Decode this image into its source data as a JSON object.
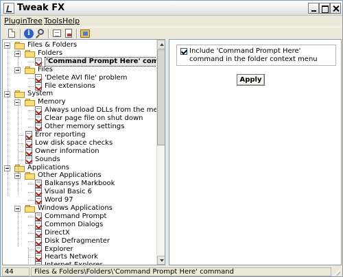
{
  "window": {
    "title": "Tweak FX"
  },
  "menu": [
    {
      "label": "Plugin"
    },
    {
      "label": "Tree"
    },
    {
      "label": "Tools"
    },
    {
      "label": "Help"
    }
  ],
  "tree": [
    {
      "label": "Files & Folders",
      "type": "folder",
      "level": 0,
      "expandable": true
    },
    {
      "label": "Folders",
      "type": "folder",
      "level": 1,
      "expandable": true
    },
    {
      "label": "'Command Prompt Here' command",
      "type": "item",
      "level": 2,
      "selected": true
    },
    {
      "label": "Files",
      "type": "folder",
      "level": 1,
      "expandable": true
    },
    {
      "label": "'Delete AVI file' problem",
      "type": "item",
      "level": 2
    },
    {
      "label": "File extensions",
      "type": "item",
      "level": 2
    },
    {
      "label": "System",
      "type": "folder",
      "level": 0,
      "expandable": true
    },
    {
      "label": "Memory",
      "type": "folder",
      "level": 1,
      "expandable": true
    },
    {
      "label": "Always unload DLLs from the memory",
      "type": "item",
      "level": 2
    },
    {
      "label": "Clear page file on shut down",
      "type": "item",
      "level": 2
    },
    {
      "label": "Other memory settings",
      "type": "item",
      "level": 2
    },
    {
      "label": "Error reporting",
      "type": "item",
      "level": 1
    },
    {
      "label": "Low disk space checks",
      "type": "item",
      "level": 1
    },
    {
      "label": "Owner information",
      "type": "item",
      "level": 1
    },
    {
      "label": "Sounds",
      "type": "item",
      "level": 1
    },
    {
      "label": "Applications",
      "type": "folder",
      "level": 0,
      "expandable": true
    },
    {
      "label": "Other Applications",
      "type": "folder",
      "level": 1,
      "expandable": true
    },
    {
      "label": "Balkansys Markbook",
      "type": "item",
      "level": 2
    },
    {
      "label": "Visual Basic 6",
      "type": "item",
      "level": 2
    },
    {
      "label": "Word 97",
      "type": "item",
      "level": 2
    },
    {
      "label": "Windows Applications",
      "type": "folder",
      "level": 1,
      "expandable": true
    },
    {
      "label": "Command Prompt",
      "type": "item",
      "level": 2
    },
    {
      "label": "Common Dialogs",
      "type": "item",
      "level": 2
    },
    {
      "label": "DirectX",
      "type": "item",
      "level": 2
    },
    {
      "label": "Disk Defragmenter",
      "type": "item",
      "level": 2
    },
    {
      "label": "Explorer",
      "type": "item",
      "level": 2
    },
    {
      "label": "Hearts Network",
      "type": "item",
      "level": 2
    },
    {
      "label": "Internet Explorer",
      "type": "item",
      "level": 2
    }
  ],
  "detail": {
    "option_label": "Include 'Command Prompt Here' command in the folder context menu",
    "option_checked": true,
    "apply_label": "Apply"
  },
  "status": {
    "count": "44",
    "path": "Files & Folders\\Folders\\'Command Prompt Here' command"
  },
  "toolbar_icons": [
    "new-document-icon",
    "info-icon",
    "search-icon",
    "note-icon",
    "document-icon",
    "image-icon"
  ]
}
